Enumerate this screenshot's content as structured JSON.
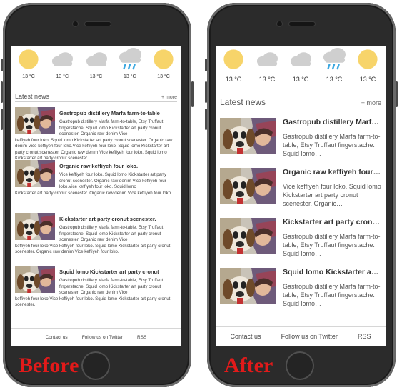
{
  "weather": [
    {
      "icon": "sun-icon",
      "temp": "13 °C"
    },
    {
      "icon": "cloud-icon",
      "temp": "13 °C"
    },
    {
      "icon": "cloud-icon",
      "temp": "13 °C"
    },
    {
      "icon": "rain-cloud-icon",
      "temp": "13 °C"
    },
    {
      "icon": "sun-icon",
      "temp": "13 °C"
    }
  ],
  "colors": {
    "sun": "#f7d46a",
    "cloud": "#cfcfcf",
    "rain": "#3aa7e0",
    "label": "#e21a1a"
  },
  "before": {
    "label": "Before",
    "news_title": "Latest news",
    "more": "+ more",
    "items": [
      {
        "title": "Gastropub distillery Marfa farm-to-table",
        "body_side": "Gastropub distillery Marfa farm-to-table, Etsy Truffaut fingerstache. Squid lomo Kickstarter art party cronut scenester. Organic raw denim Vice",
        "body_under": "keffiyeh four loko. Squid lomo Kickstarter art party cronut scenester. Organic raw denim Vice keffiyeh four loko.Vice keffiyeh four loko. Squid lomo Kickstarter art party cronut scenester. Organic raw denim Vice keffiyeh four loko. Squid lomo Kickstarter art party cronut scenester."
      },
      {
        "title": "Organic raw keffiyeh four loko.",
        "body_side": "Vice keffiyeh four loko. Squid lomo Kickstarter art party cronut scenester. Organic raw denim Vice keffiyeh four loko.Vice keffiyeh four loko. Squid lomo",
        "body_under": "Kickstarter art party cronut scenester. Organic raw denim Vice keffiyeh four loko."
      },
      {
        "title": "Kickstarter art party cronut scenester.",
        "body_side": "Gastropub distillery Marfa farm-to-table, Etsy Truffaut fingerstache. Squid lomo Kickstarter art party cronut scenester. Organic raw denim Vice",
        "body_under": "keffiyeh four loko.Vice keffiyeh four loko. Squid lomo Kickstarter art party cronut scenester. Organic raw denim Vice keffiyeh four loko."
      },
      {
        "title": "Squid lomo Kickstarter art party cronut",
        "body_side": "Gastropub distillery Marfa farm-to-table, Etsy Truffaut fingerstache. Squid lomo Kickstarter art party cronut scenester. Organic raw denim Vice",
        "body_under": "keffiyeh four loko.Vice keffiyeh four loko. Squid lomo Kickstarter art party cronut scenester."
      }
    ],
    "footer": {
      "contact": "Contact us",
      "twitter": "Follow us on Twitter",
      "rss": "RSS"
    }
  },
  "after": {
    "label": "After",
    "news_title": "Latest news",
    "more": "+ more",
    "items": [
      {
        "title": "Gastropub distillery Marfa…",
        "body": "Gastropub distillery Marfa farm-to-table, Etsy Truffaut fingerstache. Squid lomo…"
      },
      {
        "title": "Organic raw keffiyeh four…",
        "body": "Vice keffiyeh four loko. Squid lomo Kickstarter art party cronut scenester. Organic…"
      },
      {
        "title": "Kickstarter art party cront…",
        "body": "Gastropub distillery Marfa farm-to-table, Etsy Truffaut fingerstache. Squid lomo…"
      },
      {
        "title": "Squid lomo Kickstarter ar…",
        "body": "Gastropub distillery Marfa farm-to-table, Etsy Truffaut fingerstache. Squid lomo…"
      }
    ],
    "footer": {
      "contact": "Contact us",
      "twitter": "Follow us on Twitter",
      "rss": "RSS"
    }
  }
}
